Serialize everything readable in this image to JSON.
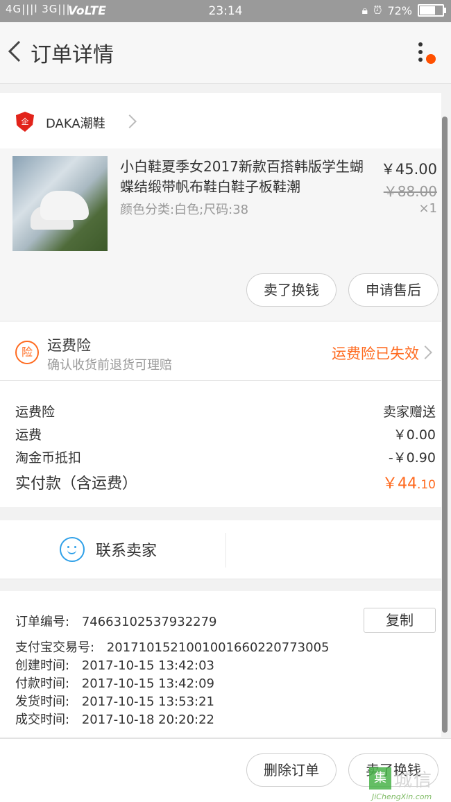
{
  "status_bar": {
    "signal": "4G|||l 3G|||",
    "volte": "VoLTE",
    "time": "23:14",
    "battery": "72%",
    "battery_level": 0.72
  },
  "header": {
    "title": "订单详情"
  },
  "shop": {
    "name": "DAKA潮鞋",
    "logo_text": "企"
  },
  "goods": {
    "title": "小白鞋夏季女2017新款百搭韩版学生蝴蝶结缎带帆布鞋白鞋子板鞋潮",
    "spec": "颜色分类:白色;尺码:38",
    "price": "￥45.00",
    "original_price": "￥88.00",
    "quantity": "×1",
    "actions": [
      "卖了换钱",
      "申请售后"
    ]
  },
  "insurance": {
    "icon_text": "险",
    "title": "运费险",
    "subtitle": "确认收货前退货可理赔",
    "status": "运费险已失效"
  },
  "fees": {
    "rows": [
      {
        "label": "运费险",
        "value": "卖家赠送"
      },
      {
        "label": "运费",
        "value": "￥0.00"
      },
      {
        "label": "淘金币抵扣",
        "value": "-￥0.90"
      }
    ],
    "total_label": "实付款（含运费）",
    "total_currency": "￥",
    "total_int": "44",
    "total_dec": ".10"
  },
  "contact": {
    "label": "联系卖家"
  },
  "order_info": {
    "copy_label": "复制",
    "rows": [
      {
        "label": "订单编号:",
        "value": "74663102537932279"
      },
      {
        "label": "支付宝交易号:",
        "value": "2017101521001001660220773005"
      },
      {
        "label": "创建时间:",
        "value": "2017-10-15  13:42:03"
      },
      {
        "label": "付款时间:",
        "value": "2017-10-15  13:42:09"
      },
      {
        "label": "发货时间:",
        "value": "2017-10-15  13:53:21"
      },
      {
        "label": "成交时间:",
        "value": "2017-10-18  20:20:22"
      }
    ]
  },
  "footer": {
    "buttons": [
      "删除订单",
      "卖了换钱"
    ]
  },
  "watermark": {
    "text": "城信",
    "box": "集",
    "sub": "JiChengXin.com"
  },
  "colors": {
    "accent": "#ff6a1f",
    "contact_blue": "#2fa0e8",
    "notify_dot": "#ff5000"
  }
}
